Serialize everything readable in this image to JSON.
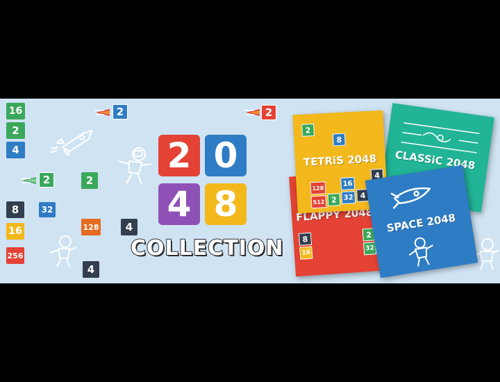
{
  "colors": {
    "background": "#cfe3f3",
    "letterbox": "#000000",
    "tile_green": "#3aa85a",
    "tile_blue": "#2e7cc4",
    "tile_dark": "#333e4f",
    "tile_yellow": "#f3b81c",
    "tile_red": "#e34234",
    "tile_orange": "#e56b1f",
    "tile_purple": "#8e52b6"
  },
  "left_tiles": {
    "t16": "16",
    "t2a": "2",
    "t4a": "4",
    "t2b": "2",
    "t2c": "2",
    "t8": "8",
    "t32": "32",
    "t16b": "16",
    "t128": "128",
    "t4b": "4",
    "t256": "256",
    "t4c": "4",
    "comet1": "2",
    "comet2": "2"
  },
  "logo": {
    "digit1": "2",
    "digit2": "0",
    "digit3": "4",
    "digit4": "8",
    "word": "COLLECTION"
  },
  "cards": {
    "tetris": {
      "title": "TETRiS 2048",
      "tiles": [
        "2",
        "8",
        "128",
        "16",
        "4",
        "512",
        "2",
        "32",
        "4"
      ]
    },
    "classic": {
      "title": "CLASSiC 2048"
    },
    "flappy": {
      "title": "FLAPPY 2048",
      "tiles": [
        "8",
        "16",
        "2",
        "32"
      ]
    },
    "space": {
      "title": "SPACE 2048"
    }
  },
  "icons": [
    "rocket-icon",
    "astronaut-icon",
    "comet-icon"
  ]
}
